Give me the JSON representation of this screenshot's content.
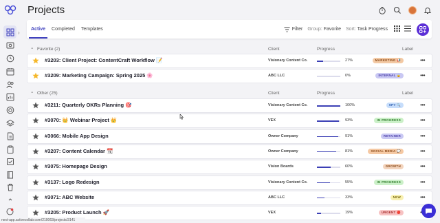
{
  "page": {
    "title": "Projects"
  },
  "rail": {
    "items": [
      {
        "icon": "grid-icon",
        "active": true
      },
      {
        "icon": "dollar-icon"
      },
      {
        "icon": "clock-icon"
      },
      {
        "icon": "calendar-icon"
      },
      {
        "icon": "people-icon"
      },
      {
        "icon": "chart-icon"
      },
      {
        "icon": "target-icon"
      },
      {
        "icon": "layers-icon"
      },
      {
        "icon": "file-icon"
      },
      {
        "icon": "clipboard-icon"
      },
      {
        "icon": "check-square-icon"
      },
      {
        "icon": "book-icon"
      },
      {
        "icon": "trash-icon"
      }
    ]
  },
  "tabs": [
    {
      "label": "Active",
      "active": true
    },
    {
      "label": "Completed"
    },
    {
      "label": "Templates"
    }
  ],
  "toolbar": {
    "filter": "Filter",
    "group_label": "Group:",
    "group_value": "Favorite",
    "sort_label": "Sort:",
    "sort_value": "Task Progress"
  },
  "sections": {
    "favorite": {
      "title": "Favorite (2)",
      "col_client": "Client",
      "col_progress": "Progress",
      "col_label": "Label"
    },
    "other": {
      "title": "Other (25)",
      "col_client": "Client",
      "col_progress": "Progress",
      "col_label": "Label"
    }
  },
  "favorite_rows": [
    {
      "name": "#3203: Client Project: ContentCraft Workflow 📝",
      "client": "Visionary Content Co.",
      "progress": 27,
      "pct": "27%",
      "label": "MARKETING 📢",
      "label_bg": "#f3c9a4",
      "label_fg": "#8a4a1a"
    },
    {
      "name": "#3209: Marketing Campaign: Spring 2025 🌸",
      "client": "ABC LLC",
      "progress": 0,
      "pct": "0%",
      "label": "INTERNAL 🔒",
      "label_bg": "#c9c8f3",
      "label_fg": "#4a3ea8"
    }
  ],
  "other_rows": [
    {
      "name": "#3211: Quarterly OKRs Planning 🎯",
      "client": "Visionary Content Co.",
      "progress": 100,
      "pct": "100%",
      "label": "SPY 🔍",
      "label_bg": "#c6ddfb",
      "label_fg": "#2f5fae"
    },
    {
      "name": "#3070: 👑 Webinar Project 👑",
      "client": "VEX",
      "progress": 93,
      "pct": "93%",
      "label": "IN PROGRESS",
      "label_bg": "#cbf0c8",
      "label_fg": "#2e7a2a"
    },
    {
      "name": "#3066: Mobile App Design",
      "client": "Owner Company",
      "progress": 91,
      "pct": "91%",
      "label": "RETAINER",
      "label_bg": "#c9c8f3",
      "label_fg": "#4a3ea8"
    },
    {
      "name": "#3207: Content Calendar 📆",
      "client": "Owner Company",
      "progress": 81,
      "pct": "81%",
      "label": "SOCIAL MEDIA 💬",
      "label_bg": "#f5c9a4",
      "label_fg": "#8a4a1a"
    },
    {
      "name": "#3075: Homepage Design",
      "client": "Vision Boards",
      "progress": 60,
      "pct": "60%",
      "label": "GROWTH",
      "label_bg": "#f3d4bd",
      "label_fg": "#8a4a1a"
    },
    {
      "name": "#3137: Logo Redesign",
      "client": "Visionary Content Co.",
      "progress": 55,
      "pct": "55%",
      "label": "IN PROGRESS",
      "label_bg": "#cbf0c8",
      "label_fg": "#2e7a2a"
    },
    {
      "name": "#3071: ABC Website",
      "client": "ABC LLC",
      "progress": 33,
      "pct": "33%",
      "label": "NEW",
      "label_bg": "#f8f0b0",
      "label_fg": "#7a6a10"
    },
    {
      "name": "#3205: Product Launch 🚀",
      "client": "VEX",
      "progress": 19,
      "pct": "19%",
      "label": "URGENT 🔴",
      "label_bg": "#f7c2c2",
      "label_fg": "#a52a2a"
    }
  ],
  "status_url": "next-app.activecollab.com/210063/projects/3141",
  "colors": {
    "accent": "#3d3fbd",
    "fab": "#5b2fd6",
    "star_fav": "#f5b72a",
    "star_other": "#555555"
  }
}
